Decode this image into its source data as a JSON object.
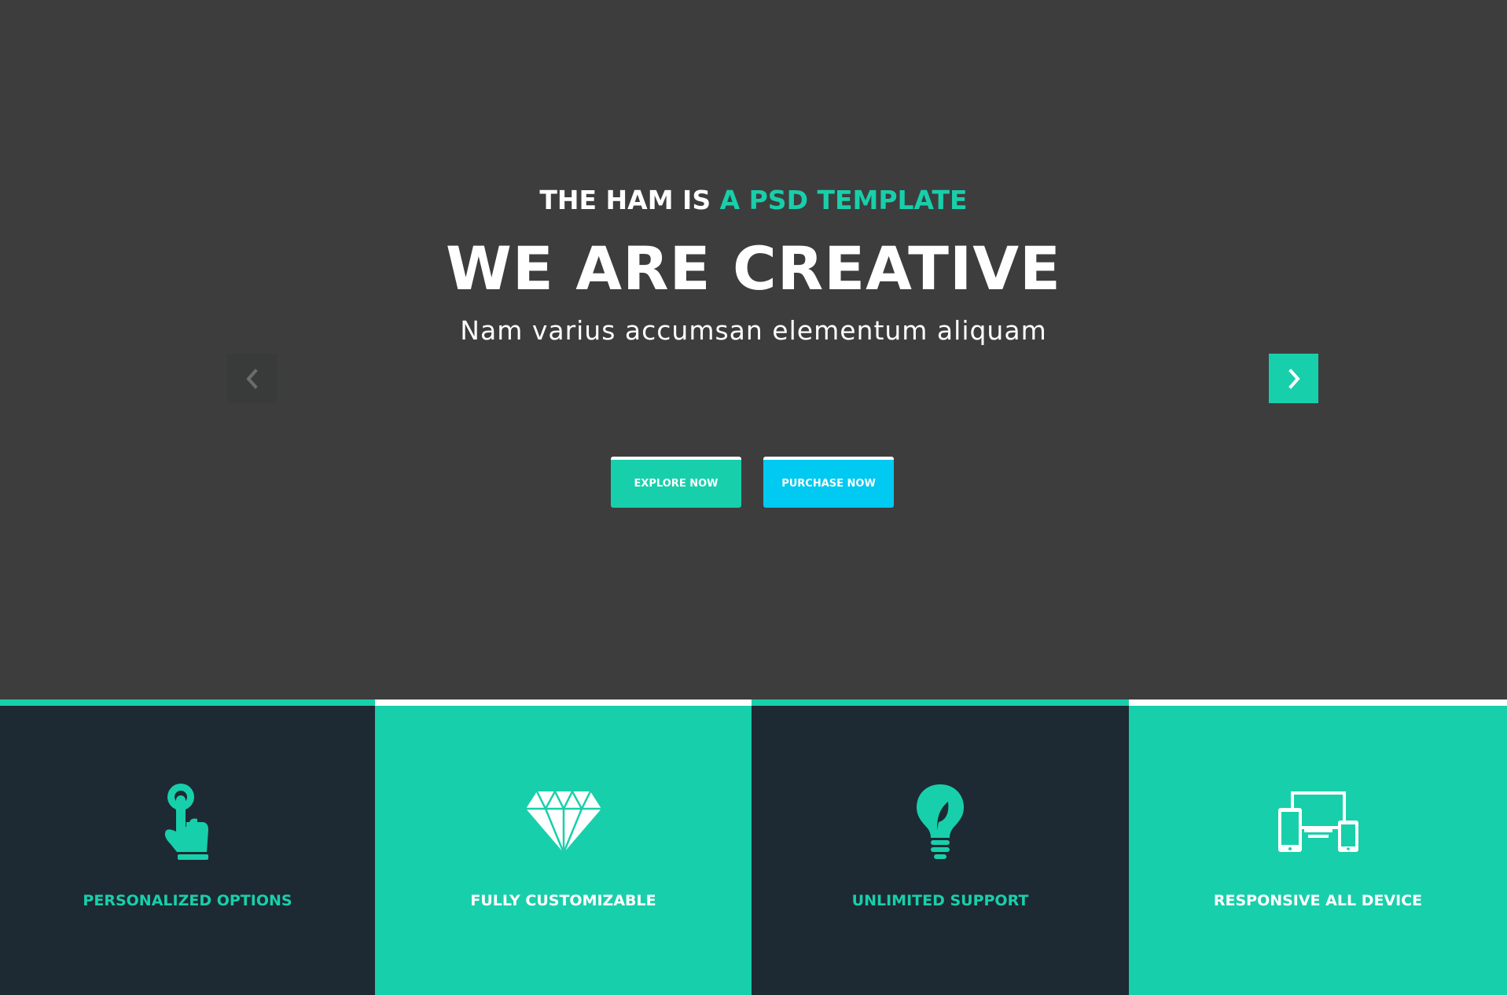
{
  "hero": {
    "kicker_white": "THE HAM IS",
    "kicker_accent": "A PSD TEMPLATE",
    "headline": "WE ARE CREATIVE",
    "subline": "Nam varius accumsan elementum aliquam",
    "buttons": {
      "explore": "EXPLORE NOW",
      "purchase": "PURCHASE NOW"
    },
    "arrows": {
      "prev_icon": "chevron-left-icon",
      "next_icon": "chevron-right-icon"
    }
  },
  "features": [
    {
      "label": "PERSONALIZED OPTIONS",
      "icon": "hand-pointer-icon",
      "theme": "dark"
    },
    {
      "label": "FULLY CUSTOMIZABLE",
      "icon": "diamond-icon",
      "theme": "teal"
    },
    {
      "label": "UNLIMITED SUPPORT",
      "icon": "lightbulb-leaf-icon",
      "theme": "dark"
    },
    {
      "label": "RESPONSIVE ALL DEVICE",
      "icon": "devices-icon",
      "theme": "teal"
    }
  ],
  "colors": {
    "background": "#3d3d3d",
    "accent": "#18cfab",
    "accent_blue": "#00c9f2",
    "dark_panel": "#1e2a33",
    "white": "#ffffff"
  }
}
